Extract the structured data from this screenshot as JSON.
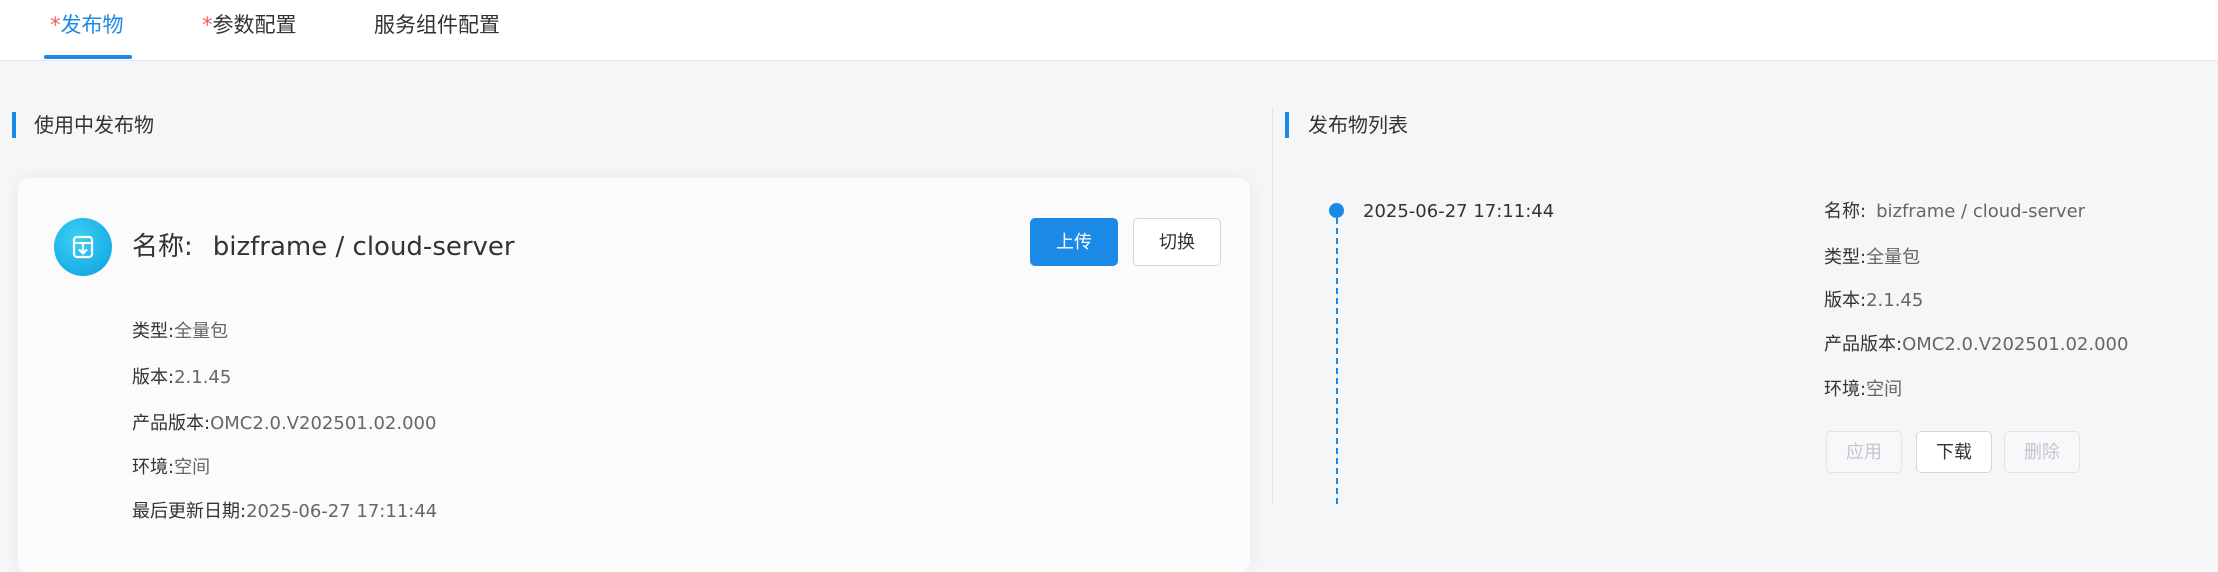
{
  "tabs": [
    {
      "required_mark": "*",
      "label": "发布物",
      "active": true
    },
    {
      "required_mark": "*",
      "label": "参数配置",
      "active": false
    },
    {
      "required_mark": "",
      "label": "服务组件配置",
      "active": false
    }
  ],
  "left_section": {
    "title": "使用中发布物",
    "name_label": "名称:",
    "name_value": "bizframe / cloud-server",
    "upload_button": "上传",
    "switch_button": "切换",
    "fields": [
      {
        "label": "类型:",
        "value": "全量包"
      },
      {
        "label": "版本:",
        "value": "2.1.45"
      },
      {
        "label": "产品版本:",
        "value": "OMC2.0.V202501.02.000"
      },
      {
        "label": "环境:",
        "value": "空间"
      },
      {
        "label": "最后更新日期:",
        "value": "2025-06-27 17:11:44"
      }
    ]
  },
  "right_section": {
    "title": "发布物列表",
    "items": [
      {
        "date": "2025-06-27 17:11:44",
        "fields": [
          {
            "label": "名称:",
            "value": "bizframe / cloud-server"
          },
          {
            "label": "类型:",
            "value": "全量包"
          },
          {
            "label": "版本:",
            "value": "2.1.45"
          },
          {
            "label": "产品版本:",
            "value": "OMC2.0.V202501.02.000"
          },
          {
            "label": "环境:",
            "value": "空间"
          }
        ],
        "buttons": {
          "apply": "应用",
          "download": "下载",
          "delete": "删除"
        }
      }
    ]
  },
  "colors": {
    "accent": "#1a8ae6",
    "required": "#f25b5b",
    "icon_bg": "#19aee6"
  },
  "icons": {
    "package": "package-download-icon"
  }
}
